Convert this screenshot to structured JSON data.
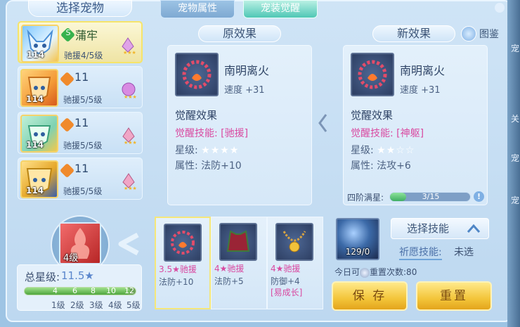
{
  "left": {
    "title": "选择宠物",
    "pets": [
      {
        "name": "蒲牢",
        "level": "114",
        "sub": "驰援4/5级",
        "type_color": "#37b24d",
        "type_symbol": "S",
        "selected": true
      },
      {
        "name": "11",
        "level": "114",
        "sub": "驰援5/5级",
        "type_color": "#f08a2c",
        "type_symbol": "",
        "selected": false
      },
      {
        "name": "11",
        "level": "114",
        "sub": "驰援5/5级",
        "type_color": "#f08a2c",
        "type_symbol": "",
        "selected": false
      },
      {
        "name": "11",
        "level": "114",
        "sub": "驰援5/5级",
        "type_color": "#f08a2c",
        "type_symbol": "",
        "selected": false
      }
    ],
    "skill_level": "4级",
    "stars": {
      "label": "总星级:",
      "value": "11.5★",
      "ticks": [
        "4",
        "6",
        "8",
        "10",
        "12"
      ],
      "grades": [
        "1级",
        "2级",
        "3级",
        "4级",
        "5级"
      ],
      "fill_fraction": 0.95
    }
  },
  "tabs": [
    {
      "label": "宠物属性",
      "active": false
    },
    {
      "label": "宠装觉醒",
      "active": true
    }
  ],
  "original": {
    "header": "原效果",
    "equip_name": "南明离火",
    "equip_stat": "速度 +31",
    "effect_title": "觉醒效果",
    "skill_line": "觉醒技能: [驰援]",
    "star_line_label": "星级:",
    "star_line_stars": "★★★★",
    "attr_line": "属性: 法防+10"
  },
  "new": {
    "header": "新效果",
    "guide": "图鉴",
    "equip_name": "南明离火",
    "equip_stat": "速度 +31",
    "effect_title": "觉醒效果",
    "skill_line": "觉醒技能: [神躯]",
    "star_line_label": "星级:",
    "star_line_stars": "★★☆☆",
    "attr_line": "属性: 法攻+6",
    "progress_label": "四阶满星:",
    "progress_text": "3/15",
    "progress_fraction": 0.2,
    "info_symbol": "!"
  },
  "materials": [
    {
      "line1": "3.5★驰援",
      "line2": "法防+10",
      "line3": "",
      "selected": true
    },
    {
      "line1": "4★驰援",
      "line2": "法防+5",
      "line3": "",
      "selected": false
    },
    {
      "line1": "4★驰援",
      "line2": "防御+4",
      "line3": "[易成长]",
      "selected": false
    }
  ],
  "actions": {
    "orb_count": "129/0",
    "select_skill": "选择技能",
    "wish_label": "祈愿技能:",
    "wish_value": "未选",
    "today_prefix": "今日可",
    "today_suffix": "重置次数:80",
    "save": "保 存",
    "reset": "重置"
  },
  "strip_chars": [
    "宠",
    "关",
    "宠",
    "宠"
  ],
  "colors": {
    "accent_pink": "#d94aa1",
    "tab_active": "#4fc7b5",
    "gold": "#f3c53a"
  }
}
